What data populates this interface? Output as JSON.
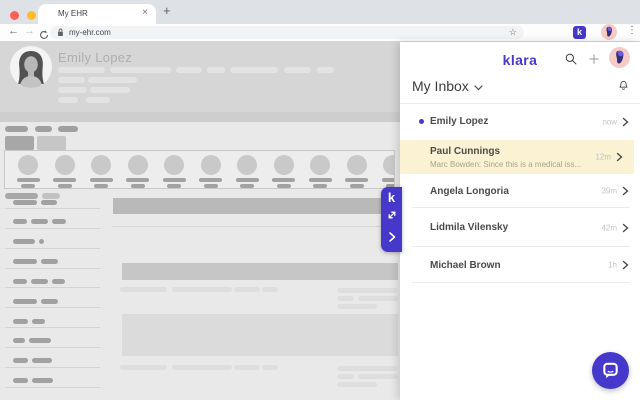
{
  "browser": {
    "tab_title": "My EHR",
    "url": "my-ehr.com",
    "extension_letter": "k"
  },
  "glyphs": {
    "close": "×",
    "plus": "+",
    "back": "←",
    "forward": "→",
    "dots": "⋮",
    "star": "☆"
  },
  "ehr": {
    "patient_name": "Emily Lopez"
  },
  "klara_tab": {
    "letter": "k"
  },
  "panel": {
    "logo": "klara",
    "inbox_title": "My Inbox",
    "conversations": [
      {
        "name": "Emily Lopez",
        "time": "now",
        "unread": true
      },
      {
        "name": "Paul Cunnings",
        "preview": "Marc Bowden: Since this is a medical iss...",
        "time": "12m",
        "highlighted": true
      },
      {
        "name": "Angela Longoria",
        "time": "39m"
      },
      {
        "name": "Lidmila Vilensky",
        "time": "42m"
      },
      {
        "name": "Michael Brown",
        "time": "1h"
      }
    ]
  },
  "colors": {
    "brand": "#4538cb",
    "highlight": "#faf2d2",
    "unread_dot": "#4538cb"
  }
}
